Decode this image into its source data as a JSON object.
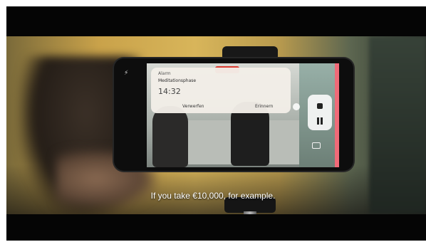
{
  "subtitle": "If you take €10,000, for example.",
  "phone_notification": {
    "app_label": "Alarm",
    "title": "Meditationsphase",
    "time": "14:32",
    "snooze_label": "Verwerfen",
    "remind_label": "Erinnern"
  },
  "icons": {
    "stop": "stop-icon",
    "pause": "pause-icon",
    "camera": "camera-icon",
    "flash": "flash-icon"
  },
  "colors": {
    "letterbox": "#050505",
    "background_warm": "#d8b55a",
    "recording_badge": "#d93a2f",
    "screen_edge": "#f06a78"
  }
}
